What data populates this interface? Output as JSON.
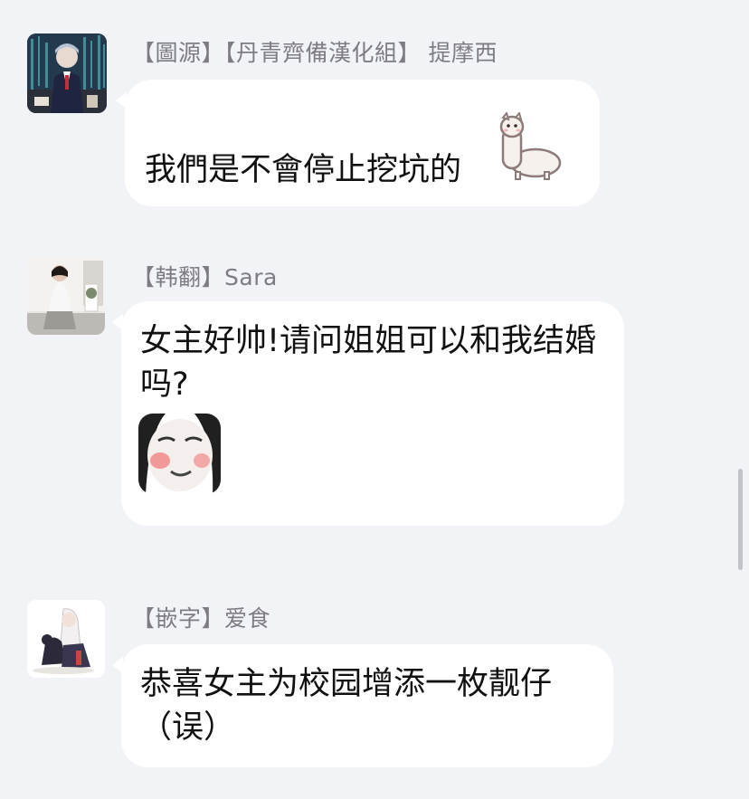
{
  "messages": [
    {
      "sender": "【圖源】【丹青齊備漢化組】 提摩西",
      "text": "我們是不會停止挖坑的",
      "sticker": "alpaca-sticker"
    },
    {
      "sender": "【韩翻】Sara",
      "text": "女主好帅!请问姐姐可以和我结婚吗?",
      "sticker": "blushing-face-meme-sticker"
    },
    {
      "sender": "【嵌字】爱食",
      "text": "恭喜女主为校园增添一枚靓仔（误）"
    }
  ]
}
